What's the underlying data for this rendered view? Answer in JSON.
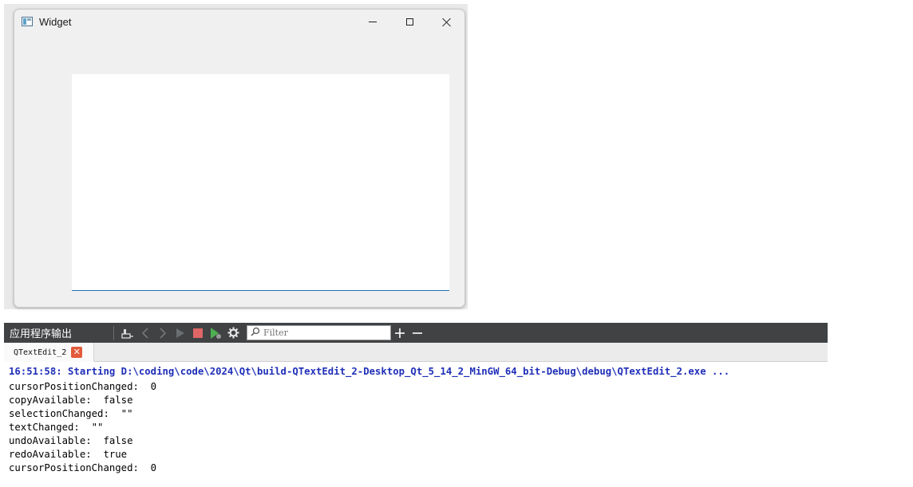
{
  "app_window": {
    "title": "Widget",
    "icons": {
      "app": "qt-widget-window-icon",
      "minimize": "minimize-icon",
      "maximize": "maximize-icon",
      "close": "close-icon"
    }
  },
  "output_pane": {
    "title": "应用程序输出",
    "toolbar_icons": [
      "clear-output-icon",
      "previous-icon",
      "next-icon",
      "run-icon",
      "stop-icon",
      "rerun-icon",
      "settings-icon",
      "zoom-in-icon",
      "zoom-out-icon"
    ],
    "filter_placeholder": "Filter",
    "tab": {
      "label": "QTextEdit_2"
    },
    "lines": [
      "16:51:58: Starting D:\\coding\\code\\2024\\Qt\\build-QTextEdit_2-Desktop_Qt_5_14_2_MinGW_64_bit-Debug\\debug\\QTextEdit_2.exe ...",
      "cursorPositionChanged:  0",
      "copyAvailable:  false",
      "selectionChanged:  \"\"",
      "textChanged:  \"\"",
      "undoAvailable:  false",
      "redoAvailable:  true",
      "cursorPositionChanged:  0"
    ]
  }
}
